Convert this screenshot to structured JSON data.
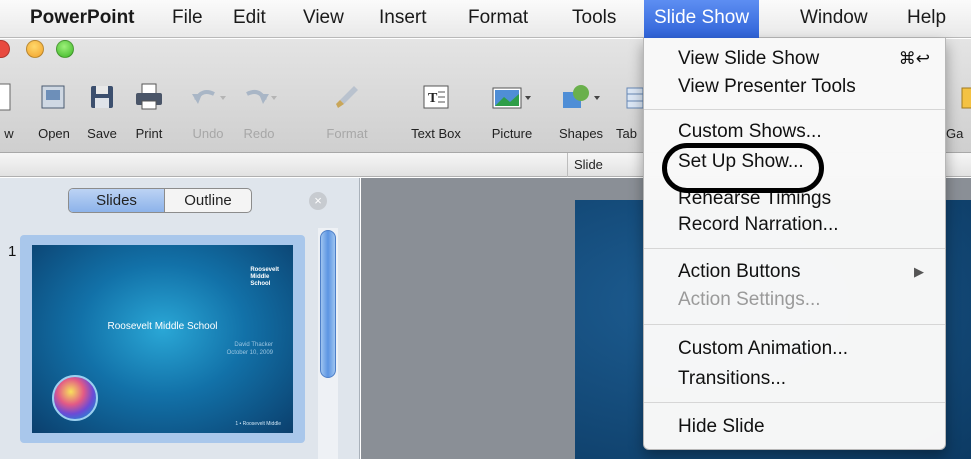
{
  "menubar": {
    "app": "PowerPoint",
    "items": [
      "File",
      "Edit",
      "View",
      "Insert",
      "Format",
      "Tools",
      "Slide Show",
      "Window",
      "Help"
    ],
    "active": "Slide Show"
  },
  "toolbar": {
    "buttons": [
      {
        "label": "w",
        "icon": "new-icon"
      },
      {
        "label": "Open",
        "icon": "open-icon"
      },
      {
        "label": "Save",
        "icon": "save-icon"
      },
      {
        "label": "Print",
        "icon": "print-icon"
      },
      {
        "label": "Undo",
        "icon": "undo-icon",
        "disabled": true
      },
      {
        "label": "Redo",
        "icon": "redo-icon",
        "disabled": true
      },
      {
        "label": "Format",
        "icon": "format-brush-icon",
        "disabled": true
      },
      {
        "label": "Text Box",
        "icon": "text-box-icon"
      },
      {
        "label": "Picture",
        "icon": "picture-icon"
      },
      {
        "label": "Shapes",
        "icon": "shapes-icon"
      },
      {
        "label": "Tab",
        "icon": "table-icon"
      },
      {
        "label": "Ga",
        "icon": "gallery-icon"
      }
    ]
  },
  "ribbon": {
    "tabs": [
      "Slide"
    ]
  },
  "left_panel": {
    "toggle": {
      "slides": "Slides",
      "outline": "Outline",
      "selected": "Slides"
    },
    "close_symbol": "×",
    "slide_number": "1",
    "thumbnail": {
      "title": "Roosevelt Middle School",
      "author_line1": "David Thacker",
      "author_line2": "October 10, 2009",
      "logo_line1": "Roosevelt",
      "logo_line2": "Middle",
      "logo_line3": "School",
      "footer": "1 • Roosevelt Middle"
    }
  },
  "dropdown": {
    "groups": [
      [
        {
          "label": "View Slide Show",
          "shortcut": "⌘↩"
        },
        {
          "label": "View Presenter Tools"
        }
      ],
      [
        {
          "label": "Custom Shows..."
        },
        {
          "label": "Set Up Show..."
        },
        {
          "label": "Rehearse Timings"
        },
        {
          "label": "Record Narration..."
        }
      ],
      [
        {
          "label": "Action Buttons",
          "submenu": "▶"
        },
        {
          "label": "Action Settings...",
          "disabled": true
        }
      ],
      [
        {
          "label": "Custom Animation..."
        },
        {
          "label": "Transitions..."
        }
      ],
      [
        {
          "label": "Hide Slide"
        }
      ]
    ]
  },
  "colors": {
    "menu_highlight": "#3a6fe0",
    "annotation": "#000000"
  }
}
